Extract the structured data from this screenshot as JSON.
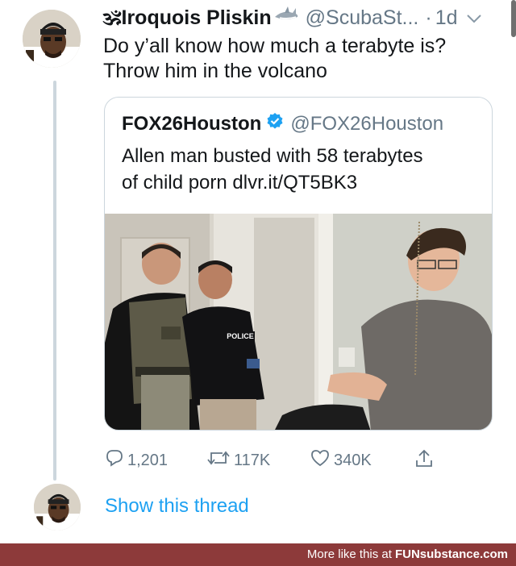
{
  "tweet": {
    "author_name": "🕉Iroquois Pliskin",
    "author_handle": "@ScubaSt...",
    "separator": "·",
    "time": "1d",
    "text_lines": [
      "Do y’all know how much a terabyte is?",
      "Throw him in the volcano"
    ]
  },
  "quoted_tweet": {
    "author_name": "FOX26Houston",
    "author_handle": "@FOX26Houston",
    "text_lines": [
      "Allen man busted with 58 terabytes",
      "of child porn dlvr.it/QT5BK3"
    ],
    "photo": {
      "vest_label": "POLICE"
    }
  },
  "actions": {
    "replies": "1,201",
    "retweets": "117K",
    "likes": "340K"
  },
  "show_thread": "Show this thread",
  "footer": {
    "prefix": "More like this at",
    "brand": "FUNsubstance.com"
  },
  "colors": {
    "link": "#1da1f2",
    "muted": "#657786",
    "verified": "#1da1f2",
    "footer_bg": "#8d3a3a"
  }
}
